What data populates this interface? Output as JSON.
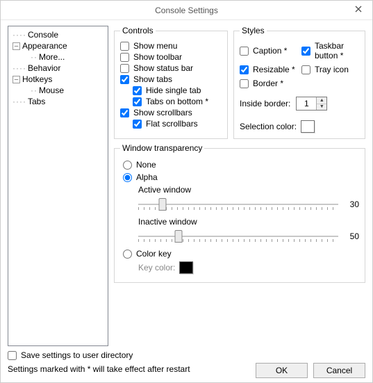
{
  "title": "Console Settings",
  "tree": {
    "items": [
      {
        "label": "Console"
      },
      {
        "label": "Appearance",
        "expanded": true
      },
      {
        "label": "More...",
        "child": true
      },
      {
        "label": "Behavior"
      },
      {
        "label": "Hotkeys",
        "expanded": true
      },
      {
        "label": "Mouse",
        "child": true
      },
      {
        "label": "Tabs"
      }
    ]
  },
  "groups": {
    "controls": {
      "legend": "Controls",
      "show_menu": {
        "label": "Show menu",
        "checked": false
      },
      "show_toolbar": {
        "label": "Show toolbar",
        "checked": false
      },
      "show_status": {
        "label": "Show status bar",
        "checked": false
      },
      "show_tabs": {
        "label": "Show tabs",
        "checked": true
      },
      "hide_single": {
        "label": "Hide single tab",
        "checked": true
      },
      "tabs_bottom": {
        "label": "Tabs on bottom *",
        "checked": true
      },
      "show_scroll": {
        "label": "Show scrollbars",
        "checked": true
      },
      "flat_scroll": {
        "label": "Flat scrollbars",
        "checked": true
      }
    },
    "styles": {
      "legend": "Styles",
      "caption": {
        "label": "Caption *",
        "checked": false
      },
      "taskbar": {
        "label": "Taskbar button *",
        "checked": true
      },
      "resizable": {
        "label": "Resizable *",
        "checked": true
      },
      "tray": {
        "label": "Tray icon",
        "checked": false
      },
      "border": {
        "label": "Border *",
        "checked": false
      },
      "inside_border_label": "Inside border:",
      "inside_border_value": "1",
      "selection_color_label": "Selection color:",
      "selection_color": "#ffffff"
    },
    "transparency": {
      "legend": "Window transparency",
      "none_label": "None",
      "alpha_label": "Alpha",
      "colorkey_label": "Color key",
      "selected": "alpha",
      "active_label": "Active window",
      "active_value": "30",
      "inactive_label": "Inactive window",
      "inactive_value": "50",
      "keycolor_label": "Key color:",
      "keycolor": "#000000"
    }
  },
  "footer": {
    "save_dir_label": "Save settings to user directory",
    "save_dir_checked": false,
    "hint": "Settings marked with * will take effect after restart",
    "ok": "OK",
    "cancel": "Cancel"
  }
}
